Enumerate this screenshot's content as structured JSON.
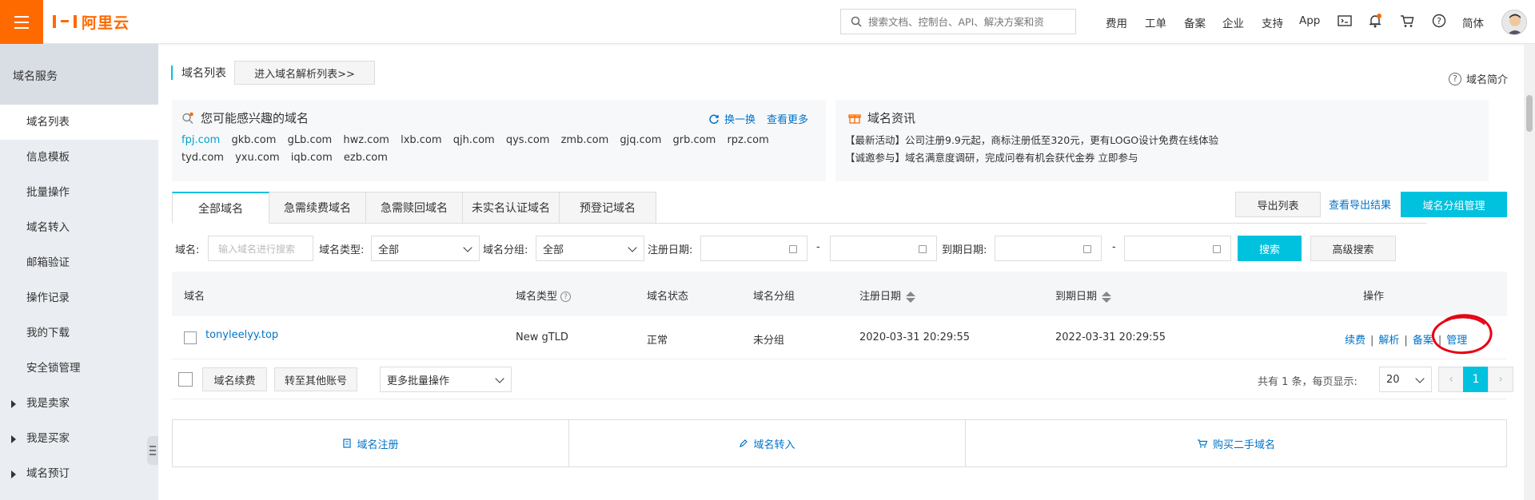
{
  "topbar": {
    "logo_text": "阿里云",
    "search_placeholder": "搜索文档、控制台、API、解决方案和资",
    "nav": [
      "费用",
      "工单",
      "备案",
      "企业",
      "支持",
      "App"
    ],
    "lang": "简体",
    "icons": [
      "terminal-icon",
      "bell-icon",
      "cart-icon",
      "help-icon"
    ],
    "accent": "#ff6a00"
  },
  "sidebar": {
    "header": "域名服务",
    "items": [
      {
        "label": "域名列表",
        "active": true
      },
      {
        "label": "信息模板"
      },
      {
        "label": "批量操作"
      },
      {
        "label": "域名转入"
      },
      {
        "label": "邮箱验证"
      },
      {
        "label": "操作记录"
      },
      {
        "label": "我的下载"
      },
      {
        "label": "安全锁管理"
      },
      {
        "label": "我是卖家",
        "expandable": true
      },
      {
        "label": "我是买家",
        "expandable": true
      },
      {
        "label": "域名预订",
        "expandable": true
      }
    ]
  },
  "main": {
    "title": "域名列表",
    "goto_dns": "进入域名解析列表>>",
    "intro": "域名简介",
    "interest": {
      "title": "您可能感兴趣的域名",
      "refresh": "换一换",
      "more": "查看更多",
      "domains": [
        "fpj.com",
        "gkb.com",
        "gLb.com",
        "hwz.com",
        "lxb.com",
        "qjh.com",
        "qys.com",
        "zmb.com",
        "gjq.com",
        "grb.com",
        "rpz.com",
        "tyd.com",
        "yxu.com",
        "iqb.com",
        "ezb.com"
      ]
    },
    "news": {
      "title": "域名资讯",
      "lines": [
        "【最新活动】公司注册9.9元起，商标注册低至320元，更有LOGO设计免费在线体验",
        "【诚邀参与】域名满意度调研，完成问卷有机会获代金券 立即参与"
      ]
    },
    "tabs": [
      "全部域名",
      "急需续费域名",
      "急需赎回域名",
      "未实名认证域名",
      "预登记域名"
    ],
    "export_list": "导出列表",
    "view_exports": "查看导出结果",
    "group_manage": "域名分组管理",
    "filters": {
      "domain_label": "域名:",
      "domain_placeholder": "输入域名进行搜索",
      "type_label": "域名类型:",
      "type_value": "全部",
      "group_label": "域名分组:",
      "group_value": "全部",
      "reg_label": "注册日期:",
      "exp_label": "到期日期:",
      "dash": "-",
      "search": "搜索",
      "advanced": "高级搜索"
    },
    "table": {
      "headers": {
        "domain": "域名",
        "type": "域名类型",
        "status": "域名状态",
        "group": "域名分组",
        "reg": "注册日期",
        "exp": "到期日期",
        "ops": "操作"
      },
      "rows": [
        {
          "domain": "tonyleelyy.top",
          "type": "New gTLD",
          "status": "正常",
          "group": "未分组",
          "reg": "2020-03-31 20:29:55",
          "exp": "2022-03-31 20:29:55"
        }
      ],
      "ops": [
        "续费",
        "解析",
        "备案",
        "管理"
      ]
    },
    "batch": {
      "renew": "域名续费",
      "transfer": "转至其他账号",
      "more": "更多批量操作",
      "total": "共有 1 条，每页显示:",
      "page_size": "20",
      "page": "1",
      "prev": "‹",
      "next": "›"
    },
    "bottom": {
      "register": "域名注册",
      "transfer_in": "域名转入",
      "buy": "购买二手域名"
    },
    "highlight_color": "#e60012"
  }
}
